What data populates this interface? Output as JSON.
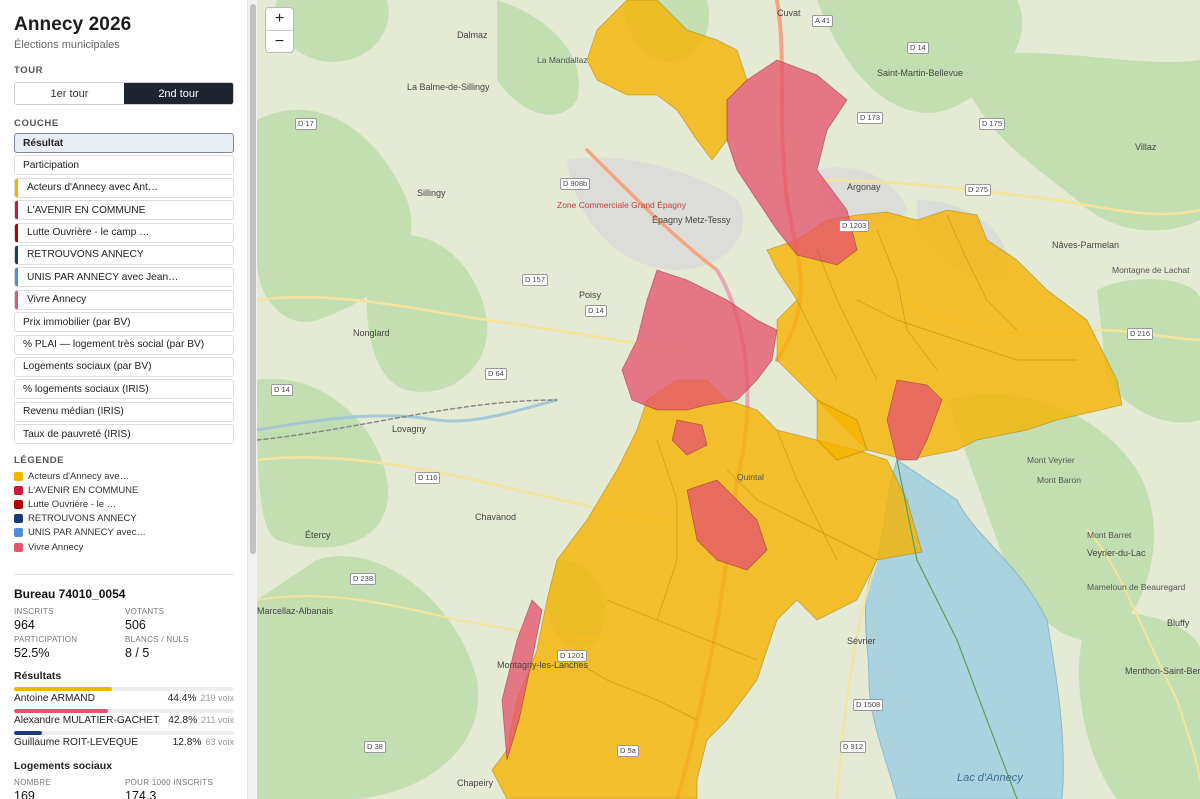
{
  "app": {
    "title": "Annecy 2026",
    "subtitle": "Élections municipales"
  },
  "tour": {
    "label": "TOUR",
    "options": [
      "1er tour",
      "2nd tour"
    ],
    "selected": "2nd tour"
  },
  "couche": {
    "label": "COUCHE",
    "selected": "Résultat",
    "items": [
      {
        "label": "Résultat"
      },
      {
        "label": "Participation"
      },
      {
        "label": "Acteurs d'Annecy avec Ant…",
        "color": "#f5b301"
      },
      {
        "label": "L'AVENIR EN COMMUNE",
        "color": "#c8193a"
      },
      {
        "label": "Lutte Ouvrière - le camp …",
        "color": "#b30000"
      },
      {
        "label": "RETROUVONS ANNECY",
        "color": "#1a3a7c"
      },
      {
        "label": "UNIS PAR ANNECY avec Jean…",
        "color": "#4a90d9"
      },
      {
        "label": "Vivre Annecy",
        "color": "#e5566e"
      },
      {
        "label": "Prix immobilier (par BV)"
      },
      {
        "label": "% PLAI — logement très social (par BV)"
      },
      {
        "label": "Logements sociaux (par BV)"
      },
      {
        "label": "% logements sociaux (IRIS)"
      },
      {
        "label": "Revenu médian (IRIS)"
      },
      {
        "label": "Taux de pauvreté (IRIS)"
      }
    ]
  },
  "legend": {
    "label": "LÉGENDE",
    "items": [
      {
        "label": "Acteurs d'Annecy ave…",
        "color": "#f5b301"
      },
      {
        "label": "L'AVENIR EN COMMUNE",
        "color": "#c8193a"
      },
      {
        "label": "Lutte Ouvrière - le …",
        "color": "#b30000"
      },
      {
        "label": "RETROUVONS ANNECY",
        "color": "#1a3a7c"
      },
      {
        "label": "UNIS PAR ANNECY avec…",
        "color": "#4a90d9"
      },
      {
        "label": "Vivre Annecy",
        "color": "#e5566e"
      }
    ]
  },
  "bureau": {
    "title": "Bureau 74010_0054",
    "stats": [
      {
        "label": "INSCRITS",
        "value": "964"
      },
      {
        "label": "VOTANTS",
        "value": "506"
      },
      {
        "label": "PARTICIPATION",
        "value": "52.5%"
      },
      {
        "label": "BLANCS / NULS",
        "value": "8 / 5"
      }
    ],
    "results_title": "Résultats",
    "results": [
      {
        "name": "Antoine ARMAND",
        "pct": "44.4%",
        "votes": "219 voix",
        "share": 0.444,
        "color": "#f5b301"
      },
      {
        "name": "Alexandre MULATIER-GACHET",
        "pct": "42.8%",
        "votes": "211 voix",
        "share": 0.428,
        "color": "#e5566e"
      },
      {
        "name": "Guillaume ROIT-LEVÊQUE",
        "pct": "12.8%",
        "votes": "63 voix",
        "share": 0.128,
        "color": "#1a3a7c"
      }
    ],
    "logements_title": "Logements sociaux",
    "logements": [
      {
        "label": "NOMBRE",
        "value": "169"
      },
      {
        "label": "POUR 1000 INSCRITS",
        "value": "174.3"
      }
    ]
  },
  "map": {
    "zoom_in": "+",
    "zoom_out": "−",
    "place_labels": [
      "Cuvat",
      "Dalmaz",
      "La Mandallaz",
      "La Balme-de-Sillingy",
      "Saint-Martin-Bellevue",
      "Sillingy",
      "Épagny Metz-Tessy",
      "Zone Commerciale Grand Épagny",
      "Argonay",
      "Nâves-Parmelan",
      "Poisy",
      "Nonglard",
      "Lovagny",
      "Montagne de Lachat",
      "Mont Veyrier",
      "Mont Baron",
      "Mont Barret",
      "Veyrier-du-Lac",
      "Chavanod",
      "Étercy",
      "Quintal",
      "Sévrier",
      "Menthon-Saint-Bernard",
      "Chapeiry",
      "Montagny-les-Lanches",
      "Marcellaz-Albanais",
      "Mameloun de Beauregard",
      "Bluffy",
      "Villaz"
    ],
    "lake_label": "Lac d'Annecy",
    "road_labels": [
      "A 41",
      "D 14",
      "D 173",
      "D 175",
      "D 17",
      "D 908b",
      "D 275",
      "D 1203",
      "D 157",
      "D 14",
      "D 216",
      "D 64",
      "D 14",
      "D 116",
      "D 238",
      "D 1201",
      "D 1508",
      "D 38",
      "D 5a",
      "D 912"
    ]
  }
}
